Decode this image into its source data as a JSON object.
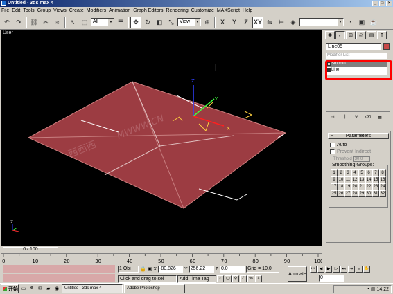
{
  "window": {
    "title": "Untitled - 3ds max 4"
  },
  "menu": [
    "File",
    "Edit",
    "Tools",
    "Group",
    "Views",
    "Create",
    "Modifiers",
    "Animation",
    "Graph Editors",
    "Rendering",
    "Customize",
    "MAXScript",
    "Help"
  ],
  "toolbar": {
    "selection_filter": "All",
    "ref_coord": "View",
    "axis_x": "X",
    "axis_y": "Y",
    "axis_z": "Z",
    "axis_xy": "XY"
  },
  "viewport": {
    "label": "User",
    "watermark": "MWWW.CN",
    "watermark_cn": "西西西"
  },
  "command_panel": {
    "object_name": "Line05",
    "modifier_list_label": "Modifier List",
    "stack": [
      {
        "label": "Smooth",
        "selected": true
      },
      {
        "label": "Line",
        "selected": false
      }
    ],
    "rollout_title": "Parameters",
    "auto_label": "Auto",
    "prevent_indirect_label": "Prevent Indirect",
    "threshold_label": "Threshold",
    "threshold_value": "30.0",
    "smoothing_groups_label": "Smoothing Groups:",
    "groups": [
      "1",
      "2",
      "3",
      "4",
      "5",
      "6",
      "7",
      "8",
      "9",
      "10",
      "11",
      "12",
      "13",
      "14",
      "15",
      "16",
      "17",
      "18",
      "19",
      "20",
      "21",
      "22",
      "23",
      "24",
      "25",
      "26",
      "27",
      "28",
      "29",
      "30",
      "31",
      "32"
    ]
  },
  "time": {
    "slider_label": "0 / 100",
    "ruler_ticks": [
      "0",
      "10",
      "20",
      "30",
      "40",
      "50",
      "60",
      "70",
      "80",
      "90",
      "100"
    ],
    "current_frame": "0"
  },
  "status": {
    "selection": "1 Obj",
    "x_label": "X",
    "x_value": "-80.826",
    "y_label": "Y",
    "y_value": "256.22",
    "z_label": "Z",
    "z_value": "0.0",
    "grid": "Grid = 10.0",
    "prompt": "Click and drag to sel",
    "add_time_tag": "Add Time Tag",
    "animate": "Animate"
  },
  "taskbar": {
    "start": "开始",
    "tasks": [
      "Untitled - 3ds max 4",
      "Adobe Photoshop"
    ],
    "clock": "14:22"
  },
  "colors": {
    "object": "#c84848",
    "highlight": "#ff0000",
    "titlebar": "#0a246a",
    "gizmo_x": "#ff2020",
    "gizmo_y": "#20ff20",
    "gizmo_z": "#2020ff"
  }
}
